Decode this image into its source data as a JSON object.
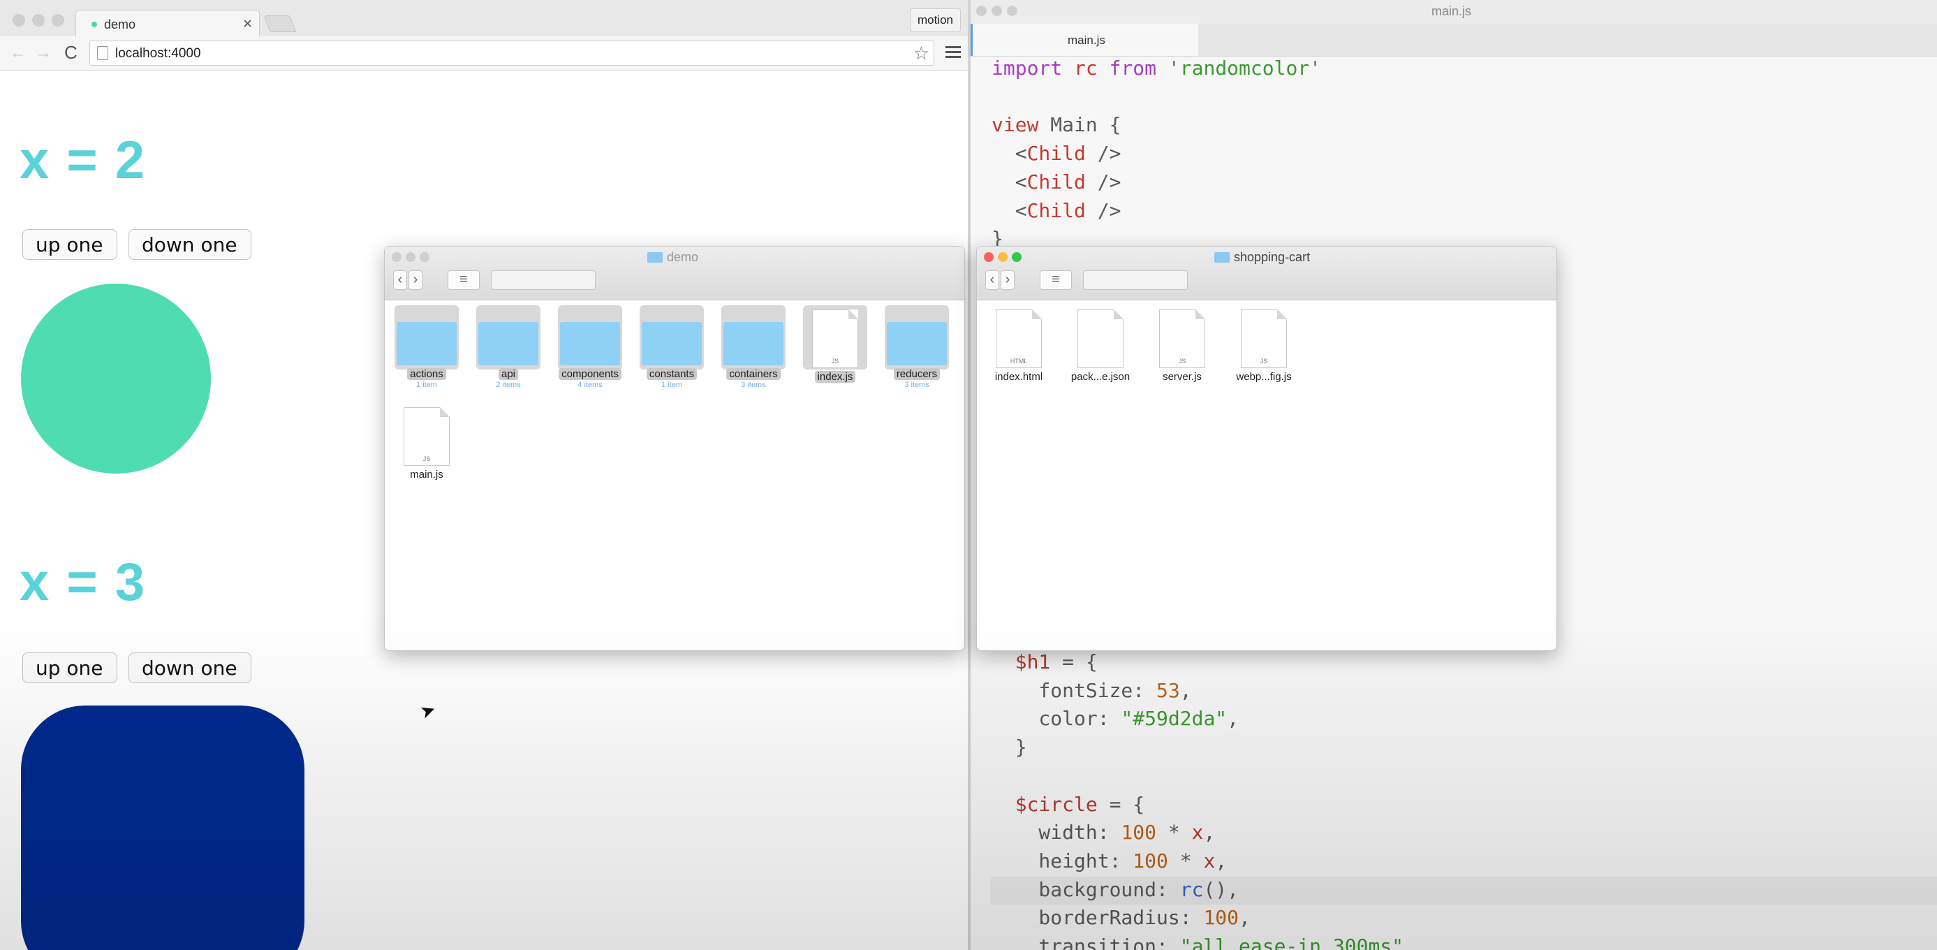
{
  "browser": {
    "tab_title": "demo",
    "tab_close": "×",
    "profile_label": "motion",
    "url": "localhost:4000",
    "nav_back": "←",
    "nav_forward": "→",
    "reload": "C",
    "star": "☆"
  },
  "demo": [
    {
      "heading": "x = 2",
      "up_label": "up one",
      "down_label": "down one",
      "shape_color": "#4fdcb0"
    },
    {
      "heading": "x = 3",
      "up_label": "up one",
      "down_label": "down one",
      "shape_color": "#002a8f"
    }
  ],
  "editor": {
    "window_title": "main.js",
    "tab_label": "main.js"
  },
  "finder_demo": {
    "title": "demo",
    "items": [
      {
        "name": "actions",
        "sub": "1 item",
        "kind": "folder"
      },
      {
        "name": "api",
        "sub": "2 items",
        "kind": "folder"
      },
      {
        "name": "components",
        "sub": "4 items",
        "kind": "folder"
      },
      {
        "name": "constants",
        "sub": "1 item",
        "kind": "folder"
      },
      {
        "name": "containers",
        "sub": "3 items",
        "kind": "folder"
      },
      {
        "name": "index.js",
        "sub": "",
        "kind": "file",
        "type": "JS"
      },
      {
        "name": "reducers",
        "sub": "3 items",
        "kind": "folder"
      },
      {
        "name": "main.js",
        "sub": "",
        "kind": "file",
        "type": "JS"
      }
    ]
  },
  "finder_cart": {
    "title": "shopping-cart",
    "items": [
      {
        "name": "index.html",
        "kind": "file",
        "type": "HTML"
      },
      {
        "name": "pack...e.json",
        "kind": "file",
        "type": ""
      },
      {
        "name": "server.js",
        "kind": "file",
        "type": "JS"
      },
      {
        "name": "webp...fig.js",
        "kind": "file",
        "type": "JS"
      }
    ]
  },
  "colors": {
    "heading": "#59d2da",
    "accent_tab": "#5aa2e6"
  }
}
